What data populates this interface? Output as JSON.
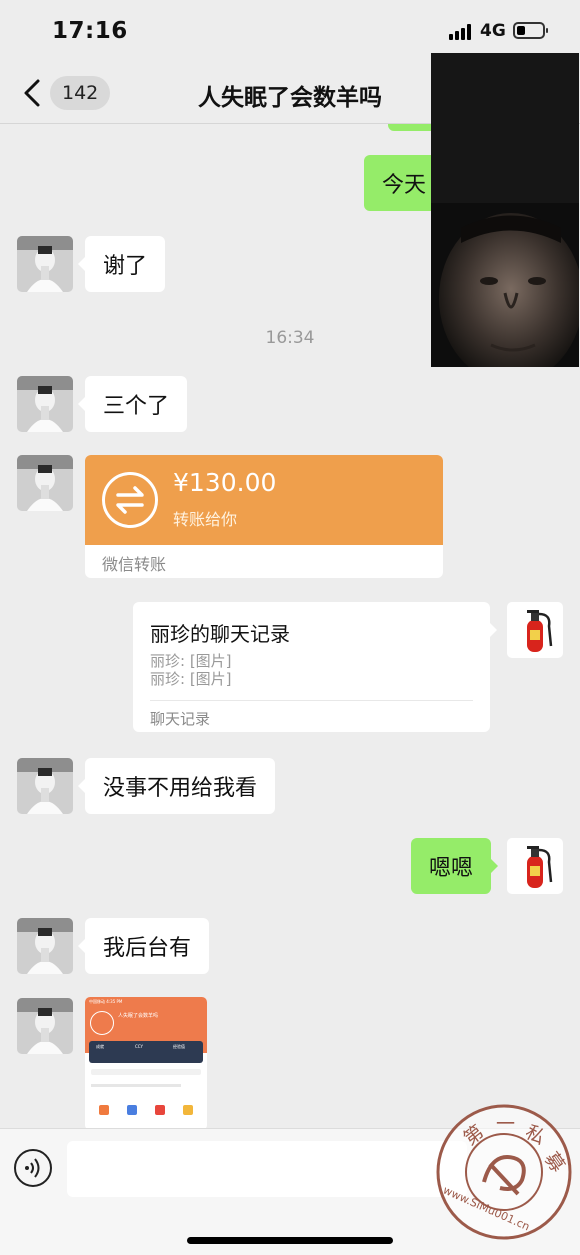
{
  "status_bar": {
    "time": "17:16",
    "network": "4G",
    "battery_level": 0.35
  },
  "nav": {
    "unread_count": "142",
    "title": "人失眠了会数羊吗"
  },
  "messages": {
    "partial_outgoing": "今天",
    "incoming_1": "谢了",
    "timestamp": "16:34",
    "incoming_2": "三个了",
    "transfer": {
      "amount": "¥130.00",
      "description": "转账给你",
      "footer": "微信转账"
    },
    "chat_record": {
      "title": "丽珍的聊天记录",
      "lines": [
        "丽珍: [图片]",
        "丽珍: [图片]"
      ],
      "footer": "聊天记录"
    },
    "incoming_3": "没事不用给我看",
    "outgoing_1": "嗯嗯",
    "incoming_4": "我后台有"
  },
  "image_message": {
    "status_text": "中国移动 4:35 PM",
    "profile_name": "人失眠了会数羊吗",
    "stats": [
      "成就",
      "CCY",
      "经验值"
    ]
  },
  "input": {
    "placeholder": ""
  },
  "watermark": {
    "text": "第一私募",
    "url": "www.SiMu001.cn"
  },
  "colors": {
    "background": "#ededed",
    "outgoing_bubble": "#95ec69",
    "transfer_orange": "#ef9f4c"
  }
}
